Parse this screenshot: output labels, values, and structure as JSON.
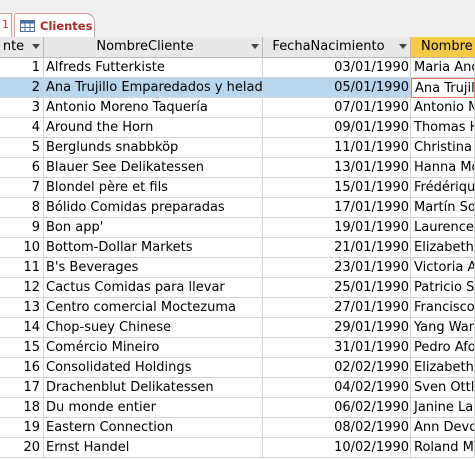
{
  "tabs": {
    "previous_tab_fragment": "1",
    "active_tab": "Clientes"
  },
  "columns": [
    {
      "key": "id",
      "label": "nte"
    },
    {
      "key": "name",
      "label": "NombreCliente"
    },
    {
      "key": "date",
      "label": "FechaNacimiento"
    },
    {
      "key": "contact",
      "label": "Nombre"
    }
  ],
  "rows": [
    {
      "id": "1",
      "name": "Alfreds Futterkiste",
      "date": "03/01/1990",
      "contact": "Maria And"
    },
    {
      "id": "2",
      "name": "Ana Trujillo Emparedados y helado",
      "date": "05/01/1990",
      "contact": "Ana Trujil"
    },
    {
      "id": "3",
      "name": "Antonio Moreno Taquería",
      "date": "07/01/1990",
      "contact": "Antonio M"
    },
    {
      "id": "4",
      "name": "Around the Horn",
      "date": "09/01/1990",
      "contact": "Thomas H"
    },
    {
      "id": "5",
      "name": "Berglunds snabbköp",
      "date": "11/01/1990",
      "contact": "Christina"
    },
    {
      "id": "6",
      "name": "Blauer See Delikatessen",
      "date": "13/01/1990",
      "contact": "Hanna Mo"
    },
    {
      "id": "7",
      "name": "Blondel père et fils",
      "date": "15/01/1990",
      "contact": "Frédériqu"
    },
    {
      "id": "8",
      "name": "Bólido Comidas preparadas",
      "date": "17/01/1990",
      "contact": "Martín So"
    },
    {
      "id": "9",
      "name": "Bon app'",
      "date": "19/01/1990",
      "contact": "Laurence"
    },
    {
      "id": "10",
      "name": "Bottom-Dollar Markets",
      "date": "21/01/1990",
      "contact": "Elizabeth"
    },
    {
      "id": "11",
      "name": "B's Beverages",
      "date": "23/01/1990",
      "contact": "Victoria A"
    },
    {
      "id": "12",
      "name": "Cactus Comidas para llevar",
      "date": "25/01/1990",
      "contact": "Patricio Si"
    },
    {
      "id": "13",
      "name": "Centro comercial Moctezuma",
      "date": "27/01/1990",
      "contact": "Francisco"
    },
    {
      "id": "14",
      "name": "Chop-suey Chinese",
      "date": "29/01/1990",
      "contact": "Yang Wan"
    },
    {
      "id": "15",
      "name": "Comércio Mineiro",
      "date": "31/01/1990",
      "contact": "Pedro Afo"
    },
    {
      "id": "16",
      "name": "Consolidated Holdings",
      "date": "02/02/1990",
      "contact": "Elizabeth"
    },
    {
      "id": "17",
      "name": "Drachenblut Delikatessen",
      "date": "04/02/1990",
      "contact": "Sven Ottli"
    },
    {
      "id": "18",
      "name": "Du monde entier",
      "date": "06/02/1990",
      "contact": "Janine Lab"
    },
    {
      "id": "19",
      "name": "Eastern Connection",
      "date": "08/02/1990",
      "contact": "Ann Devo"
    },
    {
      "id": "20",
      "name": "Ernst Handel",
      "date": "10/02/1990",
      "contact": "Roland Me"
    }
  ],
  "selected_row": 2,
  "colors": {
    "selection": "#b8d7ee",
    "active_header": "#f7c948",
    "tab_text": "#a62b2b"
  }
}
